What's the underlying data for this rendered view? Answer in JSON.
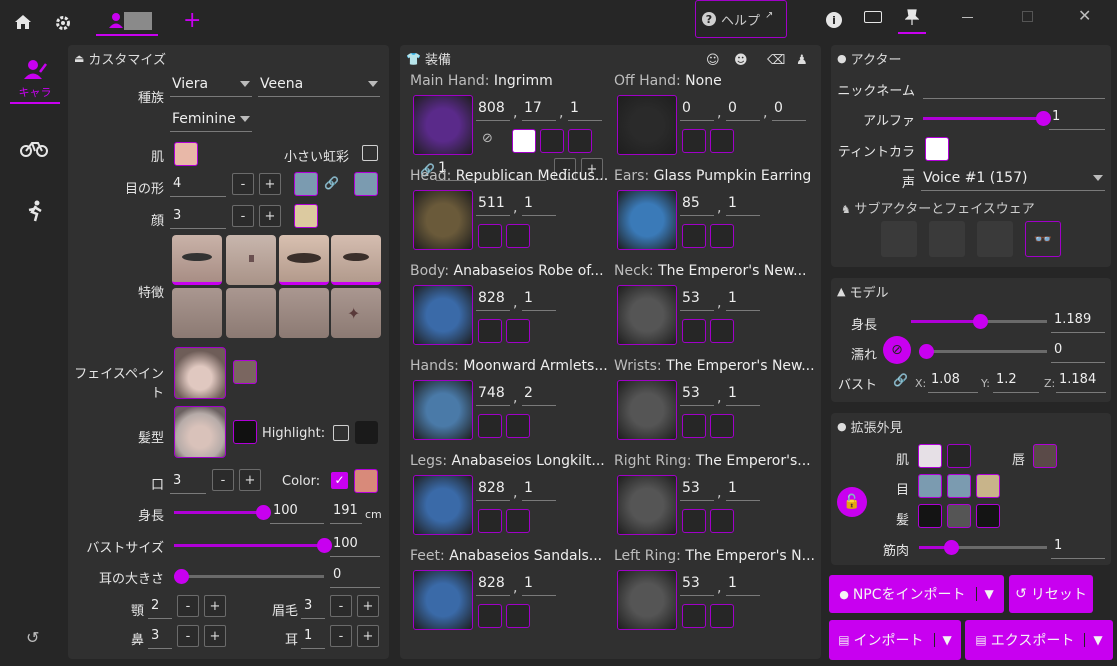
{
  "topbar": {
    "help_label": "ヘルプ"
  },
  "sidebar": {
    "items": [
      {
        "label": "キャラ"
      }
    ]
  },
  "customize": {
    "title": "カスタマイズ",
    "race_label": "種族",
    "race": "Viera",
    "clan": "Veena",
    "gender": "Feminine",
    "skin_label": "肌",
    "small_iris_label": "小さい虹彩",
    "eye_shape_label": "目の形",
    "eye_shape": "4",
    "face_label": "顔",
    "face": "3",
    "features_label": "特徴",
    "facepaint_label": "フェイスペイント",
    "hair_label": "髪型",
    "highlight_label": "Highlight:",
    "mouth_label": "口",
    "mouth": "3",
    "color_label": "Color:",
    "height_label": "身長",
    "height": "100",
    "height_cm": "191",
    "cm": "cm",
    "bust_label": "バストサイズ",
    "bust": "100",
    "ear_label": "耳の大きさ",
    "ear": "0",
    "jaw_label": "顎",
    "jaw": "2",
    "brow_label": "眉毛",
    "brow": "3",
    "nose_label": "鼻",
    "nose": "3",
    "ears_label": "耳",
    "ears": "1",
    "colors": {
      "skin": "#e8b8a8",
      "eye1": "#7b9bb0",
      "eye2": "#7b9bb0",
      "face": "#dccaa0",
      "paint": "#7a6660",
      "hair": "#111111",
      "highlight": "#1a1a1a",
      "lip": "#d88a7a"
    }
  },
  "equip": {
    "title": "装備",
    "slots": [
      {
        "slot": "Main Hand:",
        "name": "Ingrimm",
        "vals": [
          "808",
          "17",
          "1"
        ],
        "dye": "1"
      },
      {
        "slot": "Off Hand:",
        "name": "None",
        "vals": [
          "0",
          "0",
          "0"
        ]
      },
      {
        "slot": "Head:",
        "name": "Republican Medicus...",
        "vals": [
          "511",
          "1"
        ]
      },
      {
        "slot": "Ears:",
        "name": "Glass Pumpkin Earring",
        "vals": [
          "85",
          "1"
        ]
      },
      {
        "slot": "Body:",
        "name": "Anabaseios Robe of...",
        "vals": [
          "828",
          "1"
        ]
      },
      {
        "slot": "Neck:",
        "name": "The Emperor's New...",
        "vals": [
          "53",
          "1"
        ]
      },
      {
        "slot": "Hands:",
        "name": "Moonward Armlets...",
        "vals": [
          "748",
          "2"
        ]
      },
      {
        "slot": "Wrists:",
        "name": "The Emperor's New...",
        "vals": [
          "53",
          "1"
        ]
      },
      {
        "slot": "Legs:",
        "name": "Anabaseios Longkilt...",
        "vals": [
          "828",
          "1"
        ]
      },
      {
        "slot": "Right Ring:",
        "name": "The Emperor's...",
        "vals": [
          "53",
          "1"
        ]
      },
      {
        "slot": "Feet:",
        "name": "Anabaseios Sandals...",
        "vals": [
          "828",
          "1"
        ]
      },
      {
        "slot": "Left Ring:",
        "name": "The Emperor's N...",
        "vals": [
          "53",
          "1"
        ]
      }
    ]
  },
  "actor": {
    "title": "アクター",
    "nickname_label": "ニックネーム",
    "alpha_label": "アルファ",
    "alpha": "1",
    "alpha_frac": 1.0,
    "tint_label": "ティントカラー",
    "voice_label": "声",
    "voice": "Voice #1 (157)",
    "sub_label": "サブアクターとフェイスウェア"
  },
  "model": {
    "title": "モデル",
    "height_label": "身長",
    "height": "1.189",
    "height_frac": 0.55,
    "wet_label": "濡れ",
    "wet": "0",
    "bust_label": "バスト",
    "bx": "1.08",
    "by": "1.2",
    "bz": "1.184",
    "x": "X:",
    "y": "Y:",
    "z": "Z:"
  },
  "ext": {
    "title": "拡張外見",
    "skin_label": "肌",
    "lip_label": "唇",
    "eye_label": "目",
    "hair_label": "髪",
    "muscle_label": "筋肉",
    "muscle": "1",
    "muscle_frac": 0.2
  },
  "buttons": {
    "import_npc": "NPCをインポート",
    "reset": "リセット",
    "import": "インポート",
    "export": "エクスポート"
  }
}
